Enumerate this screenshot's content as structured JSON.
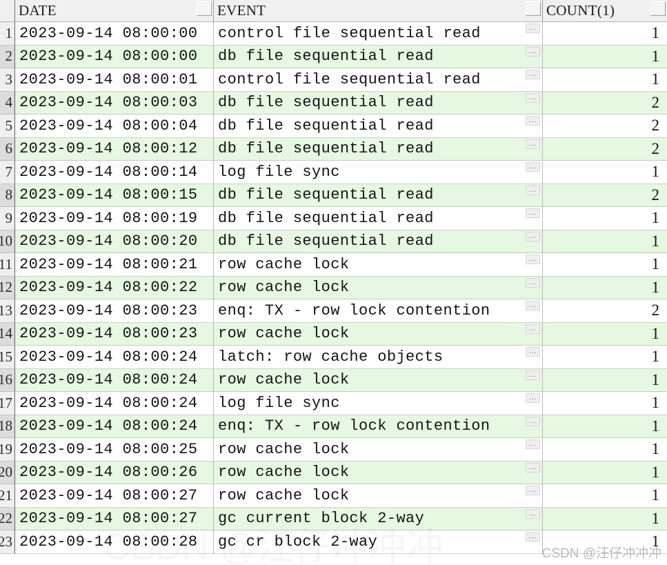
{
  "grid": {
    "columns": [
      {
        "key": "rownum",
        "label": ""
      },
      {
        "key": "date",
        "label": "DATE"
      },
      {
        "key": "event",
        "label": "EVENT"
      },
      {
        "key": "count",
        "label": "COUNT(1)"
      }
    ],
    "header_button_icon": "column-menu-icon",
    "cell_expand_icon": "ellipsis-icon",
    "cell_expand_label": "...",
    "alt_row_color": "#e6f7e2",
    "header_color": "#f0f0f0",
    "rows": [
      {
        "num": "1",
        "date": "2023-09-14 08:00:00",
        "event": "control file sequential read",
        "count": "1"
      },
      {
        "num": "2",
        "date": "2023-09-14 08:00:00",
        "event": "db file sequential read",
        "count": "1"
      },
      {
        "num": "3",
        "date": "2023-09-14 08:00:01",
        "event": "control file sequential read",
        "count": "1"
      },
      {
        "num": "4",
        "date": "2023-09-14 08:00:03",
        "event": "db file sequential read",
        "count": "2"
      },
      {
        "num": "5",
        "date": "2023-09-14 08:00:04",
        "event": "db file sequential read",
        "count": "2"
      },
      {
        "num": "6",
        "date": "2023-09-14 08:00:12",
        "event": "db file sequential read",
        "count": "2"
      },
      {
        "num": "7",
        "date": "2023-09-14 08:00:14",
        "event": "log file sync",
        "count": "1"
      },
      {
        "num": "8",
        "date": "2023-09-14 08:00:15",
        "event": "db file sequential read",
        "count": "2"
      },
      {
        "num": "9",
        "date": "2023-09-14 08:00:19",
        "event": "db file sequential read",
        "count": "1"
      },
      {
        "num": "10",
        "date": "2023-09-14 08:00:20",
        "event": "db file sequential read",
        "count": "1"
      },
      {
        "num": "11",
        "date": "2023-09-14 08:00:21",
        "event": "row cache lock",
        "count": "1"
      },
      {
        "num": "12",
        "date": "2023-09-14 08:00:22",
        "event": "row cache lock",
        "count": "1"
      },
      {
        "num": "13",
        "date": "2023-09-14 08:00:23",
        "event": "enq: TX - row lock contention",
        "count": "2"
      },
      {
        "num": "14",
        "date": "2023-09-14 08:00:23",
        "event": "row cache lock",
        "count": "1"
      },
      {
        "num": "15",
        "date": "2023-09-14 08:00:24",
        "event": "latch: row cache objects",
        "count": "1"
      },
      {
        "num": "16",
        "date": "2023-09-14 08:00:24",
        "event": "row cache lock",
        "count": "1"
      },
      {
        "num": "17",
        "date": "2023-09-14 08:00:24",
        "event": "log file sync",
        "count": "1"
      },
      {
        "num": "18",
        "date": "2023-09-14 08:00:24",
        "event": "enq: TX - row lock contention",
        "count": "1"
      },
      {
        "num": "19",
        "date": "2023-09-14 08:00:25",
        "event": "row cache lock",
        "count": "1"
      },
      {
        "num": "20",
        "date": "2023-09-14 08:00:26",
        "event": "row cache lock",
        "count": "1"
      },
      {
        "num": "21",
        "date": "2023-09-14 08:00:27",
        "event": "row cache lock",
        "count": "1"
      },
      {
        "num": "22",
        "date": "2023-09-14 08:00:27",
        "event": "gc current block 2-way",
        "count": "1"
      },
      {
        "num": "23",
        "date": "2023-09-14 08:00:28",
        "event": "gc cr block 2-way",
        "count": "1"
      }
    ]
  },
  "watermark": {
    "text": "CSDN @汪仔冲冲冲"
  }
}
